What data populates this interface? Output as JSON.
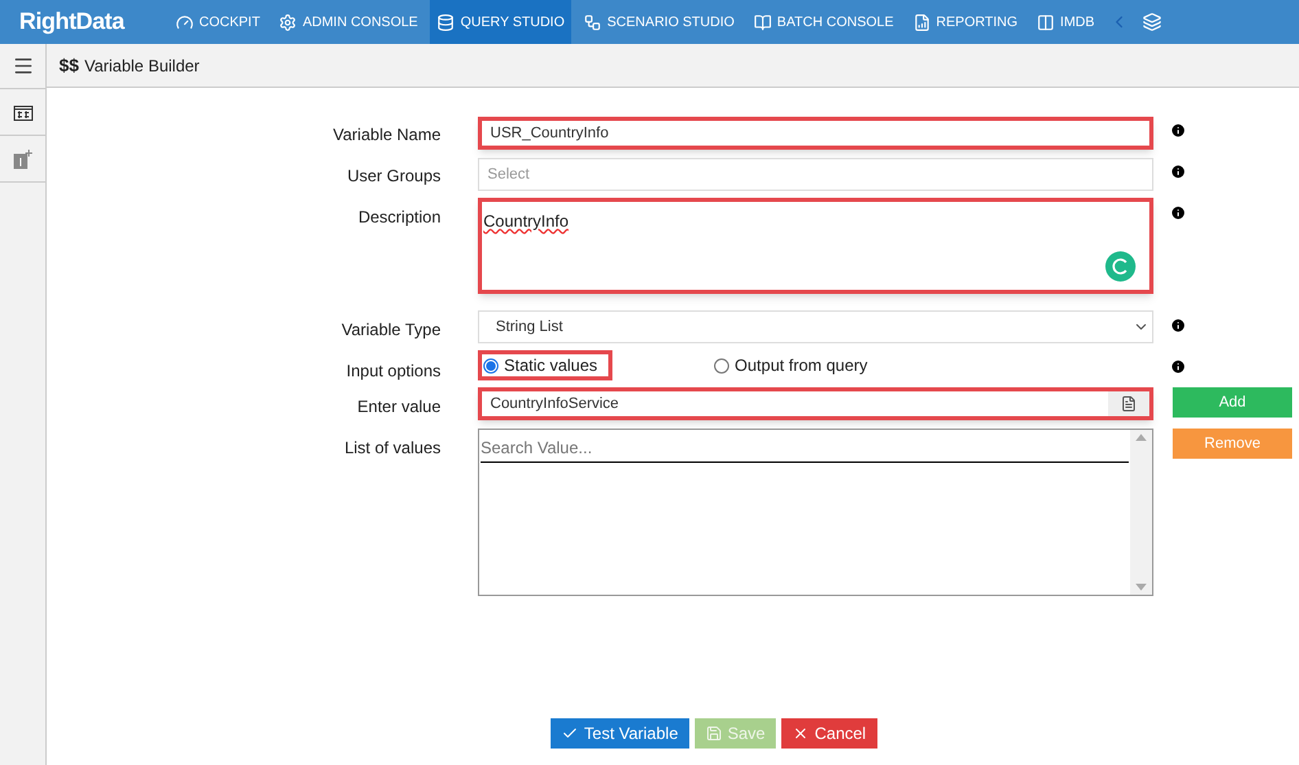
{
  "app": {
    "logo": "RightData"
  },
  "nav": [
    {
      "label": "COCKPIT",
      "selected": false
    },
    {
      "label": "ADMIN CONSOLE",
      "selected": false
    },
    {
      "label": "QUERY STUDIO",
      "selected": true
    },
    {
      "label": "SCENARIO STUDIO",
      "selected": false
    },
    {
      "label": "BATCH CONSOLE",
      "selected": false
    },
    {
      "label": "REPORTING",
      "selected": false
    },
    {
      "label": "IMDB",
      "selected": false
    }
  ],
  "page": {
    "icon": "$$",
    "title": "Variable Builder"
  },
  "form": {
    "fields": [
      {
        "kind": "text",
        "label": "Variable Name",
        "value": "USR_CountryInfo",
        "highlighted": true
      },
      {
        "kind": "text",
        "label": "User Groups",
        "placeholder": "Select",
        "highlighted": false
      },
      {
        "kind": "textarea",
        "label": "Description",
        "value": "CountryInfo",
        "highlighted": true
      },
      {
        "kind": "select",
        "label": "Variable Type",
        "value": "String List",
        "highlighted": false
      },
      {
        "kind": "radio",
        "label": "Input options",
        "options": [
          {
            "label": "Static values",
            "selected": true,
            "highlighted": true
          },
          {
            "label": "Output from query",
            "selected": false,
            "highlighted": false
          }
        ]
      },
      {
        "kind": "entry",
        "label": "Enter value",
        "value": "CountryInfoService",
        "highlighted": true,
        "button": "Add"
      },
      {
        "kind": "list",
        "label": "List of values",
        "placeholder": "Search Value...",
        "button": "Remove"
      }
    ]
  },
  "actions": [
    {
      "label": "Test Variable",
      "kind": "test",
      "disabled": false
    },
    {
      "label": "Save",
      "kind": "save",
      "disabled": true
    },
    {
      "label": "Cancel",
      "kind": "cancel",
      "disabled": false
    }
  ]
}
